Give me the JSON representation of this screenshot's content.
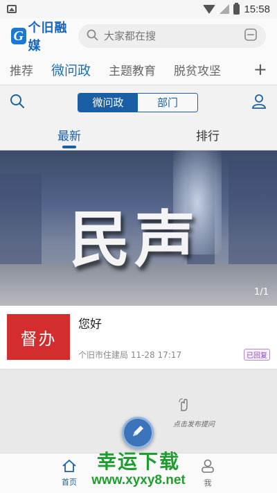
{
  "status_bar": {
    "time": "15:58"
  },
  "app": {
    "logo_text": "个旧融媒",
    "logo_letter": "G",
    "search_placeholder": "大家都在搜"
  },
  "channel_tabs": [
    {
      "label": "推荐",
      "active": false
    },
    {
      "label": "微问政",
      "active": true
    },
    {
      "label": "主题教育",
      "active": false
    },
    {
      "label": "脱贫攻坚",
      "active": false
    }
  ],
  "channel_add": "+",
  "segment": {
    "left": "微问政",
    "right": "部门"
  },
  "sort_tabs": {
    "latest": "最新",
    "ranking": "排行"
  },
  "banner": {
    "text": "民声",
    "pager_current": "1",
    "pager_sep": "/",
    "pager_total": "1"
  },
  "list": [
    {
      "thumb_text": "督办",
      "title": "您好",
      "source": "个旧市住建局 11-28 17:17",
      "badge": "已回复"
    }
  ],
  "fab_hint": "点击发布提问",
  "bottom_nav": {
    "home": "首页",
    "me": "我"
  },
  "watermark": {
    "line1": "幸运下载",
    "line2": "www.xyxy8.net"
  },
  "colors": {
    "brand_blue": "#1a5fa6",
    "thumb_red": "#d42d2d",
    "badge_purple": "#8a4bb8",
    "watermark_green": "#1e9e2f"
  }
}
